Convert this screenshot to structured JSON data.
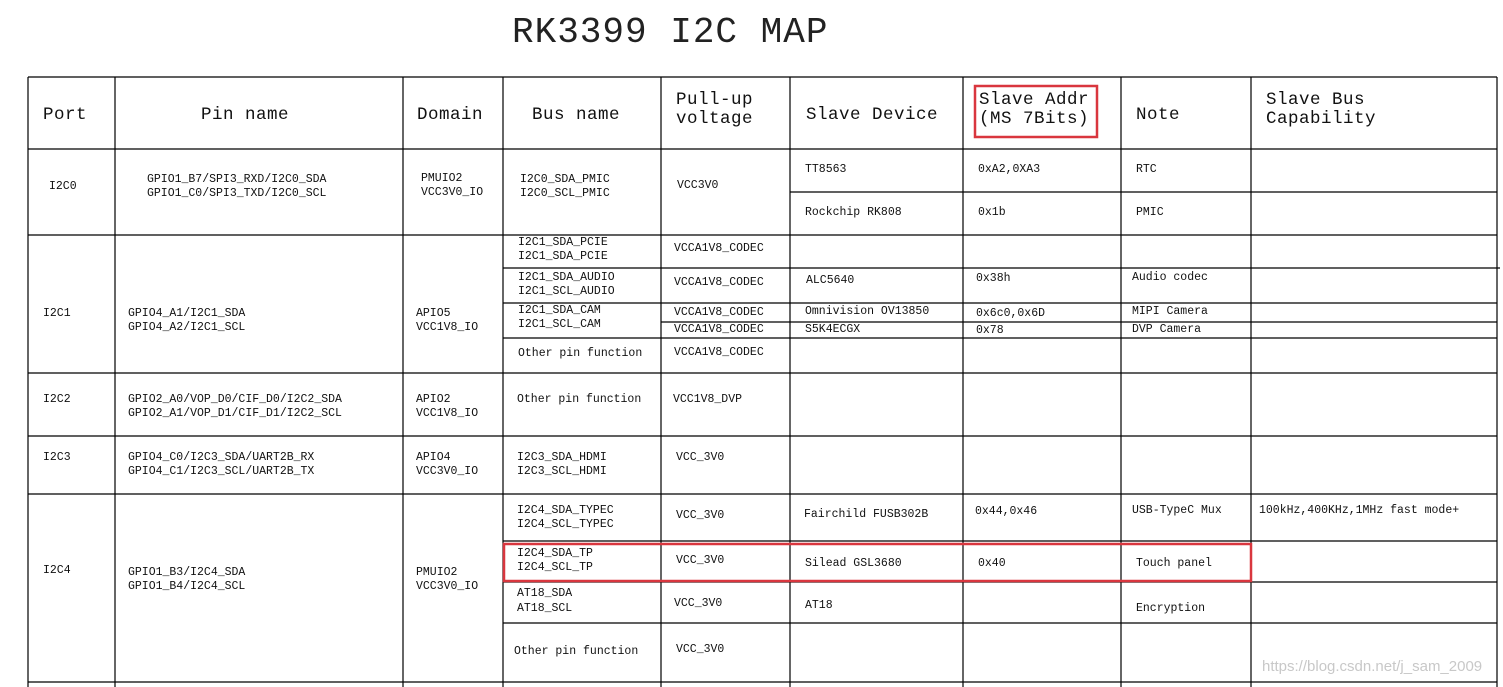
{
  "title": "RK3399 I2C MAP",
  "headers": {
    "port": "Port",
    "pin_name": "Pin name",
    "domain": "Domain",
    "bus_name": "Bus name",
    "pullup_l1": "Pull-up",
    "pullup_l2": "voltage",
    "slave_device": "Slave Device",
    "slave_addr_l1": "Slave Addr",
    "slave_addr_l2": "(MS 7Bits)",
    "note": "Note",
    "capability_l1": "Slave Bus",
    "capability_l2": "Capability"
  },
  "i2c0": {
    "port": "I2C0",
    "pin_l1": "GPIO1_B7/SPI3_RXD/I2C0_SDA",
    "pin_l2": "GPIO1_C0/SPI3_TXD/I2C0_SCL",
    "domain_l1": "PMUIO2",
    "domain_l2": "VCC3V0_IO",
    "bus_l1": "I2C0_SDA_PMIC",
    "bus_l2": "I2C0_SCL_PMIC",
    "pullup": "VCC3V0",
    "rows": [
      {
        "device": "TT8563",
        "addr": "0xA2,0XA3",
        "note": "RTC"
      },
      {
        "device": "Rockchip RK808",
        "addr": "0x1b",
        "note": "PMIC"
      }
    ]
  },
  "i2c1": {
    "port": "I2C1",
    "pin_l1": "GPIO4_A1/I2C1_SDA",
    "pin_l2": "GPIO4_A2/I2C1_SCL",
    "domain_l1": "APIO5",
    "domain_l2": "VCC1V8_IO",
    "rows": [
      {
        "bus_l1": "I2C1_SDA_PCIE",
        "bus_l2": "I2C1_SDA_PCIE",
        "pullup": "VCCA1V8_CODEC",
        "device": "",
        "addr": "",
        "note": ""
      },
      {
        "bus_l1": "I2C1_SDA_AUDIO",
        "bus_l2": "I2C1_SCL_AUDIO",
        "pullup": "VCCA1V8_CODEC",
        "device": "ALC5640",
        "addr": "0x38h",
        "note": "Audio codec"
      },
      {
        "bus_l1": "I2C1_SDA_CAM",
        "bus_l2": "I2C1_SCL_CAM",
        "pullup": "VCCA1V8_CODEC",
        "device": "Omnivision OV13850",
        "addr": "0x6c0,0x6D",
        "note": "MIPI Camera"
      },
      {
        "pullup": "VCCA1V8_CODEC",
        "device": "S5K4ECGX",
        "addr": "0x78",
        "note": "DVP Camera"
      },
      {
        "bus_l1": "Other pin function",
        "pullup": "VCCA1V8_CODEC"
      }
    ]
  },
  "i2c2": {
    "port": "I2C2",
    "pin_l1": "GPIO2_A0/VOP_D0/CIF_D0/I2C2_SDA",
    "pin_l2": "GPIO2_A1/VOP_D1/CIF_D1/I2C2_SCL",
    "domain_l1": "APIO2",
    "domain_l2": "VCC1V8_IO",
    "bus_l1": "Other pin function",
    "pullup": "VCC1V8_DVP"
  },
  "i2c3": {
    "port": "I2C3",
    "pin_l1": "GPIO4_C0/I2C3_SDA/UART2B_RX",
    "pin_l2": "GPIO4_C1/I2C3_SCL/UART2B_TX",
    "domain_l1": "APIO4",
    "domain_l2": "VCC3V0_IO",
    "bus_l1": "I2C3_SDA_HDMI",
    "bus_l2": "I2C3_SCL_HDMI",
    "pullup": "VCC_3V0"
  },
  "i2c4": {
    "port": "I2C4",
    "pin_l1": "GPIO1_B3/I2C4_SDA",
    "pin_l2": "GPIO1_B4/I2C4_SCL",
    "domain_l1": "PMUIO2",
    "domain_l2": "VCC3V0_IO",
    "rows": [
      {
        "bus_l1": "I2C4_SDA_TYPEC",
        "bus_l2": "I2C4_SCL_TYPEC",
        "pullup": "VCC_3V0",
        "device": "Fairchild FUSB302B",
        "addr": "0x44,0x46",
        "note": "USB-TypeC Mux",
        "cap": "100kHz,400KHz,1MHz fast mode+"
      },
      {
        "bus_l1": "I2C4_SDA_TP",
        "bus_l2": "I2C4_SCL_TP",
        "pullup": "VCC_3V0",
        "device": "Silead GSL3680",
        "addr": "0x40",
        "note": "Touch panel"
      },
      {
        "bus_l1": "AT18_SDA",
        "bus_l2": "AT18_SCL",
        "pullup": "VCC_3V0",
        "device": "AT18",
        "note": "Encryption"
      },
      {
        "bus_l1": "Other pin function",
        "pullup": "VCC_3V0"
      }
    ]
  },
  "watermark": "https://blog.csdn.net/j_sam_2009",
  "colors": {
    "highlight": "#d9363e",
    "grid": "#000000"
  }
}
